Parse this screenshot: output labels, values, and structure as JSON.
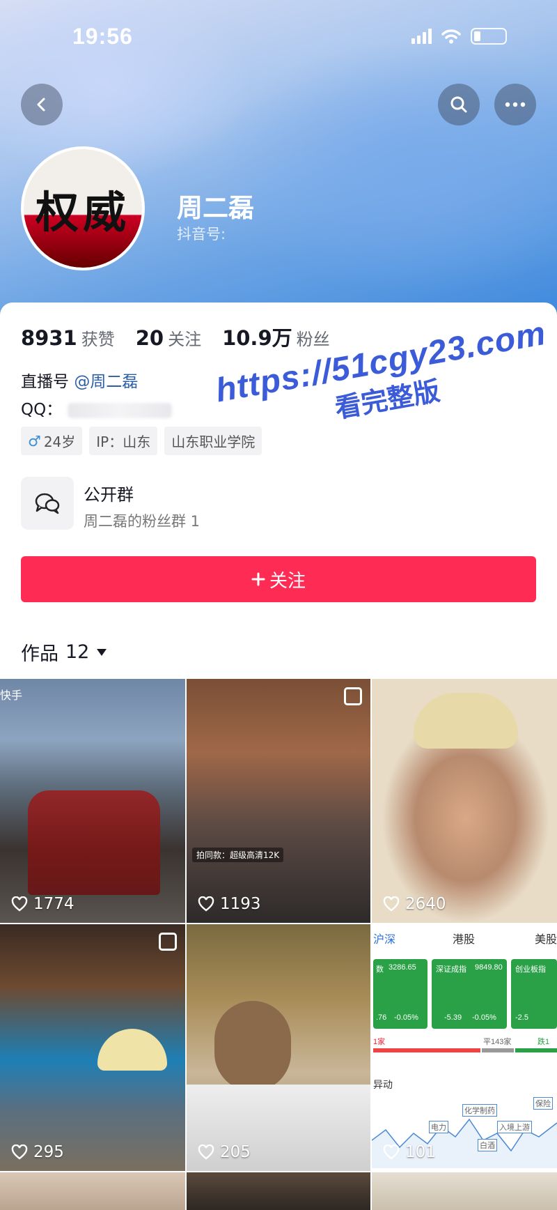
{
  "status_bar": {
    "time": "19:56"
  },
  "profile": {
    "name": "周二磊",
    "id_label": "抖音号:",
    "avatar_text": "权威"
  },
  "stats": [
    {
      "value": "8931",
      "label": "获赞"
    },
    {
      "value": "20",
      "label": "关注"
    },
    {
      "value": "10.9万",
      "label": "粉丝"
    }
  ],
  "bio": {
    "live_prefix": "直播号",
    "live_handle": "@周二磊",
    "qq_label": "QQ："
  },
  "tags": [
    {
      "icon": "male-icon",
      "label": "24岁"
    },
    {
      "label": "IP：山东"
    },
    {
      "label": "山东职业学院"
    }
  ],
  "group": {
    "title": "公开群",
    "subtitle": "周二磊的粉丝群 1"
  },
  "follow_button": {
    "label": "关注"
  },
  "works_tab": {
    "label": "作品",
    "count": "12"
  },
  "videos": [
    {
      "likes": "1774",
      "overlay": "快手"
    },
    {
      "likes": "1193",
      "overlay": "拍同款：超级高清12K"
    },
    {
      "likes": "2640"
    },
    {
      "likes": "295"
    },
    {
      "likes": "205"
    },
    {
      "likes": "101"
    }
  ],
  "stock_thumbnail": {
    "tabs": [
      "沪深",
      "港股",
      "美股"
    ],
    "cards": [
      {
        "name": "数",
        "value": "3286.65",
        "change": "-0.05%",
        "delta": ".76"
      },
      {
        "name": "深证成指",
        "value": "9849.80",
        "change": "-0.05%",
        "delta": "-5.39"
      },
      {
        "name": "创业板指",
        "value": "",
        "change": "-2.5",
        "delta": ""
      }
    ],
    "row_labels": [
      "1家",
      "平143家",
      "跌1"
    ],
    "section": "异动",
    "chart_labels": [
      "化学制药",
      "保险",
      "电力",
      "入境上游",
      "白酒"
    ]
  },
  "watermark": {
    "url": "https://51cgy23.com",
    "text": "看完整版"
  },
  "colors": {
    "accent": "#fe2c55",
    "link": "#2d5fa6",
    "watermark": "#3b5bd9"
  }
}
